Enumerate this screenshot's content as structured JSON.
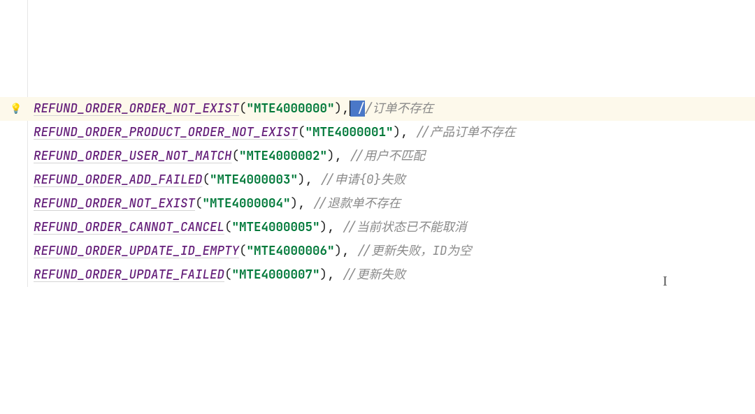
{
  "lines": [
    {
      "name": "REFUND_ORDER_ORDER_NOT_EXIST",
      "code": "\"MTE4000000\"",
      "after": ",",
      "cursor": true,
      "sel": " /",
      "comment": "/订单不存在",
      "hl": true
    },
    {
      "name": "REFUND_ORDER_PRODUCT_ORDER_NOT_EXIST",
      "code": "\"MTE4000001\"",
      "after": ", ",
      "comment": "//产品订单不存在"
    },
    {
      "name": "REFUND_ORDER_USER_NOT_MATCH",
      "code": "\"MTE4000002\"",
      "after": ", ",
      "comment": "//用户不匹配"
    },
    {
      "name": "REFUND_ORDER_ADD_FAILED",
      "code": "\"MTE4000003\"",
      "after": ", ",
      "comment": "//申请{0}失败"
    },
    {
      "name": "REFUND_ORDER_NOT_EXIST",
      "code": "\"MTE4000004\"",
      "after": ", ",
      "comment": "//退款单不存在"
    },
    {
      "name": "REFUND_ORDER_CANNOT_CANCEL",
      "code": "\"MTE4000005\"",
      "after": ", ",
      "comment": "//当前状态已不能取消"
    },
    {
      "name": "REFUND_ORDER_UPDATE_ID_EMPTY",
      "code": "\"MTE4000006\"",
      "after": ", ",
      "comment": "//更新失败，ID为空"
    },
    {
      "name": "REFUND_ORDER_UPDATE_FAILED",
      "code": "\"MTE4000007\"",
      "after": ", ",
      "comment": "//更新失败"
    }
  ],
  "ibeam": "I"
}
